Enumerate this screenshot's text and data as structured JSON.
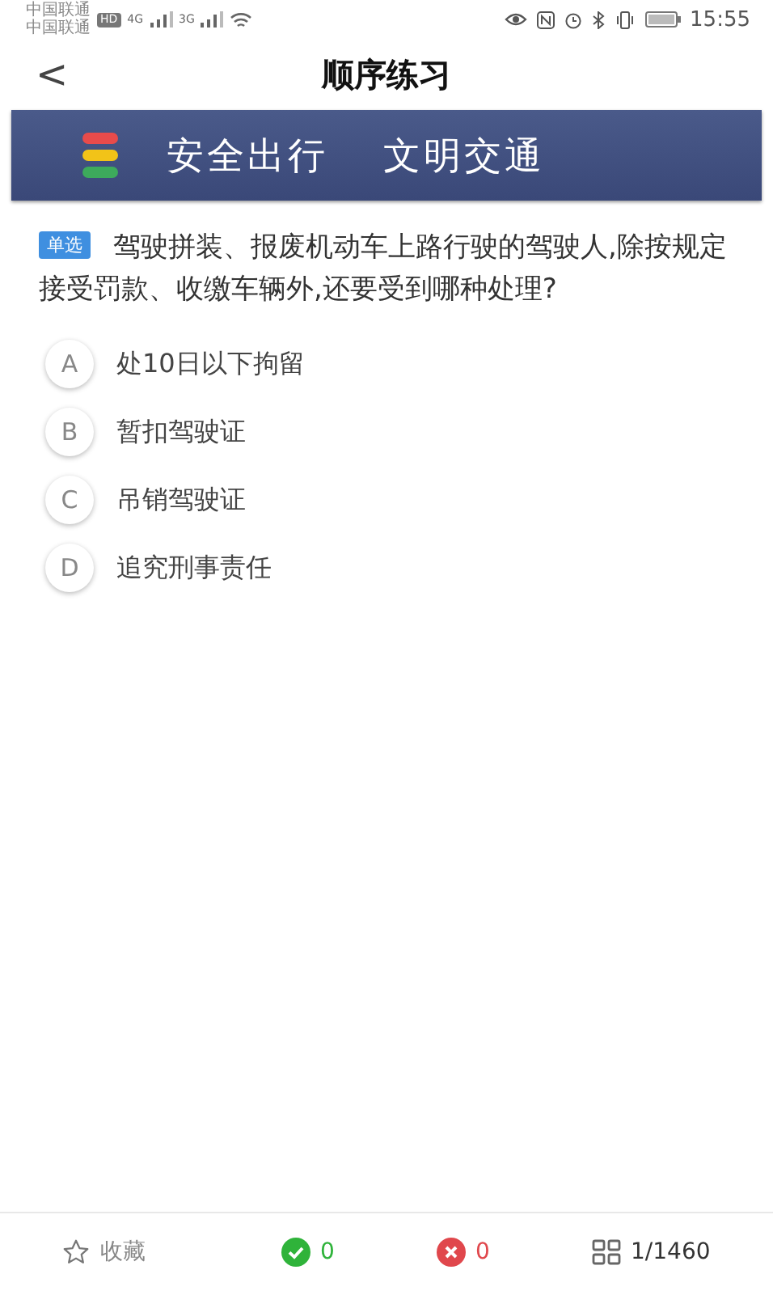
{
  "status_bar": {
    "carriers": [
      "中国联通",
      "中国联通"
    ],
    "hd": "HD",
    "networks": [
      "4G",
      "3G"
    ],
    "time": "15:55"
  },
  "header": {
    "back": "<",
    "title": "顺序练习"
  },
  "banner": {
    "texts": [
      "安全出行",
      "文明交通"
    ]
  },
  "question": {
    "tag": "单选",
    "text": "驾驶拼装、报废机动车上路行驶的驾驶人,除按规定接受罚款、收缴车辆外,还要受到哪种处理?"
  },
  "options": [
    {
      "letter": "A",
      "text": "处10日以下拘留",
      "selected": false
    },
    {
      "letter": "B",
      "text": "暂扣驾驶证",
      "selected": false
    },
    {
      "letter": "C",
      "text": "吊销驾驶证",
      "selected": false
    },
    {
      "letter": "D",
      "text": "追究刑事责任",
      "selected": false
    }
  ],
  "bottom_bar": {
    "favorite": "收藏",
    "correct": "0",
    "wrong": "0",
    "progress": "1/1460"
  }
}
